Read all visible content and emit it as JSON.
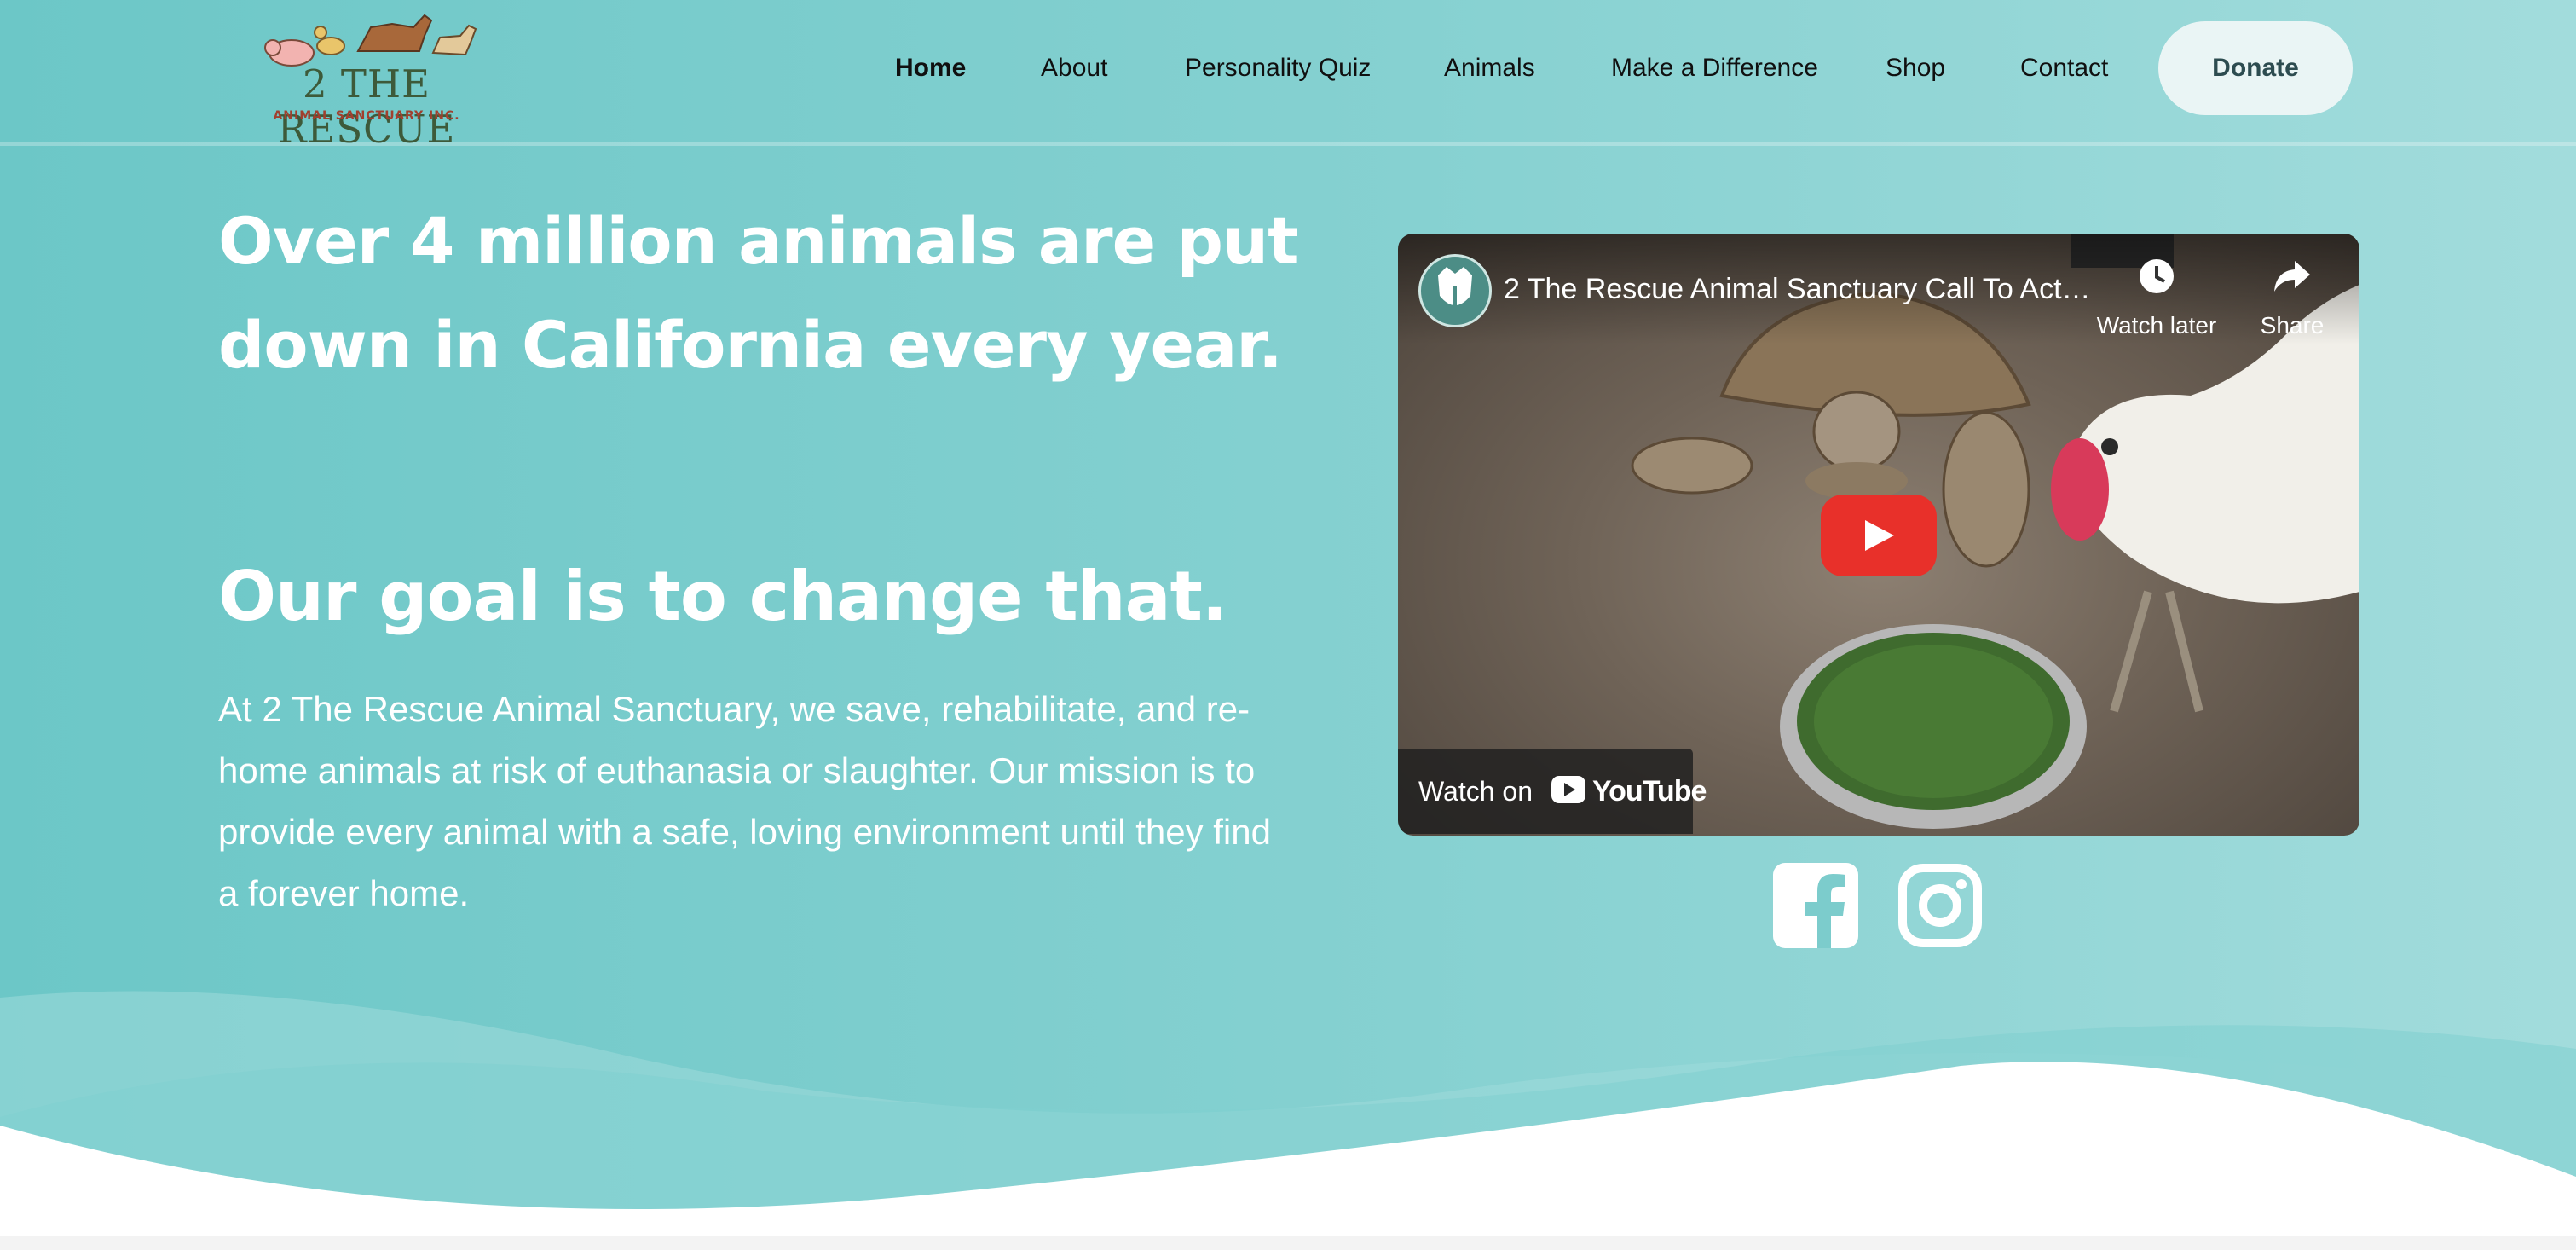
{
  "logo": {
    "title": "2 THE RESCUE",
    "subtitle": "ANIMAL SANCTUARY INC."
  },
  "nav": {
    "items": [
      {
        "label": "Home",
        "active": true
      },
      {
        "label": "About"
      },
      {
        "label": "Personality Quiz"
      },
      {
        "label": "Animals"
      },
      {
        "label": "Make a Difference"
      },
      {
        "label": "Shop"
      },
      {
        "label": "Contact"
      }
    ],
    "donate_label": "Donate"
  },
  "hero": {
    "headline": "Over 4 million animals are put down in California every year.",
    "subheadline": "Our goal is to change that.",
    "body": "At 2 The Rescue Animal Sanctuary, we save, rehabilitate, and re-home animals at risk of euthanasia or slaughter. Our mission is to provide every animal with a safe, loving environment until they find a forever home."
  },
  "video": {
    "title": "2 The Rescue Animal Sanctuary Call To Action",
    "watch_later_label": "Watch later",
    "share_label": "Share",
    "watch_on_label": "Watch on",
    "youtube_wordmark": "YouTube"
  },
  "social": {
    "icons": [
      "facebook-icon",
      "instagram-icon"
    ]
  },
  "colors": {
    "background": "#7ccccc",
    "donate_bg": "#eaf5f5",
    "play_red": "#e8302a",
    "text_white": "#ffffff"
  }
}
